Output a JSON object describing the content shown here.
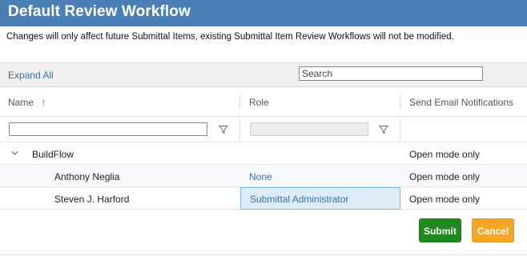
{
  "dialog": {
    "title": "Default Review Workflow",
    "notice": "Changes will only affect future Submittal Items, existing Submittal Item Review Workflows will not be modified."
  },
  "toolbar": {
    "expand_all": "Expand All",
    "search_placeholder": "Search"
  },
  "grid": {
    "columns": {
      "name": "Name",
      "sort_indicator": "↑",
      "role": "Role",
      "email": "Send Email Notifications"
    },
    "rows": [
      {
        "name": "BuildFlow",
        "role": "",
        "email": "Open mode only",
        "expanded": true,
        "level": 0
      },
      {
        "name": "Anthony Neglia",
        "role": "None",
        "email": "Open mode only",
        "level": 1
      },
      {
        "name": "Steven J. Harford",
        "role": "Submittal Administrator",
        "email": "Open mode only",
        "level": 1,
        "selected_cell": "role"
      }
    ]
  },
  "buttons": {
    "submit": "Submit",
    "cancel": "Cancel"
  },
  "colors": {
    "titlebar": "#4a7fb5",
    "link": "#3a6fb0",
    "submit": "#1e8a1e",
    "cancel": "#f5a623",
    "selected_cell": "#dcecf9"
  },
  "icons": {
    "filter": "filter-icon",
    "expand": "chevron-down-icon",
    "sort": "sort-ascending-icon"
  }
}
